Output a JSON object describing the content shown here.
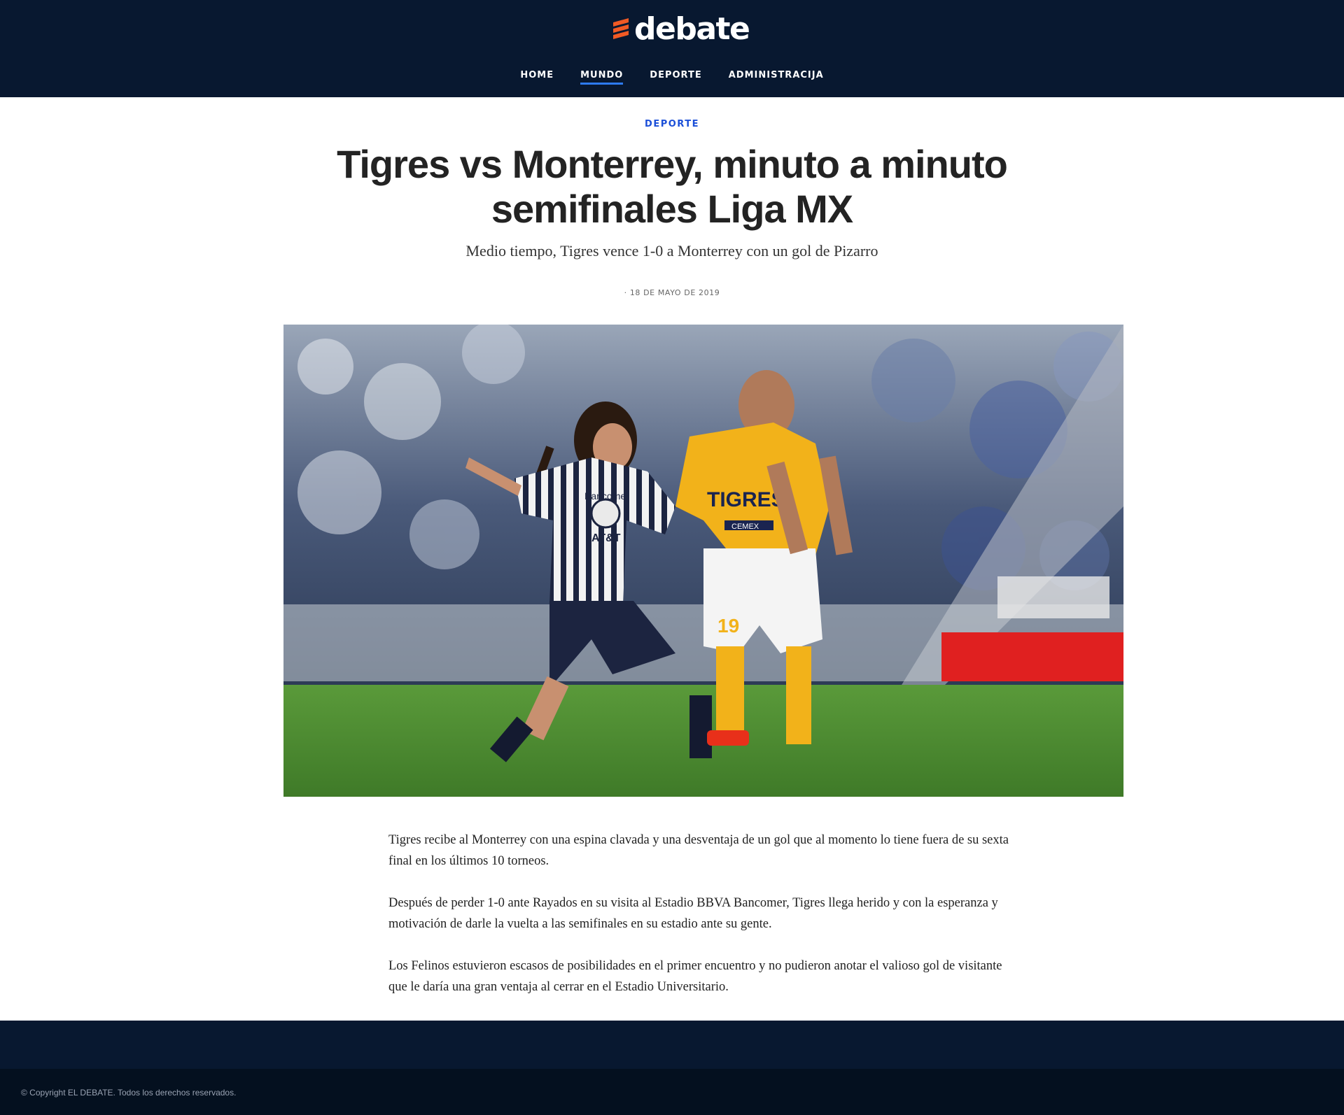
{
  "header": {
    "logo_text": "debate",
    "brand_color": "#f15a24",
    "nav": [
      {
        "label": "HOME",
        "active": false
      },
      {
        "label": "MUNDO",
        "active": true
      },
      {
        "label": "DEPORTE",
        "active": false
      },
      {
        "label": "ADMINISTRACIJA",
        "active": false
      }
    ]
  },
  "article": {
    "category": "DEPORTE",
    "title": "Tigres vs Monterrey, minuto a minuto semifinales Liga MX",
    "subtitle": "Medio tiempo, Tigres vence 1-0 a Monterrey con un gol de Pizarro",
    "date": "· 18 DE MAYO DE 2019",
    "hero_image": {
      "jersey_texts": [
        "BBVA Bancomer",
        "AT&T",
        "TIGRES",
        "CEMEX",
        "19"
      ]
    },
    "paragraphs": [
      "Tigres recibe al Monterrey con una espina clavada y una desventaja de un gol que al momento lo tiene fuera de su sexta final en los últimos 10 torneos.",
      "Después de perder 1-0 ante Rayados en su visita al Estadio BBVA Bancomer, Tigres llega herido y con la esperanza y motivación de darle la vuelta a las semifinales en su estadio ante su gente.",
      "Los Felinos estuvieron escasos de posibilidades en el primer encuentro y no pudieron anotar el valioso gol de visitante que le daría una gran ventaja al cerrar en el Estadio Universitario."
    ]
  },
  "footer": {
    "copyright": "© Copyright EL DEBATE. Todos los derechos reservados."
  },
  "colors": {
    "header_bg": "#081830",
    "accent_blue": "#1b4fd8",
    "nav_underline": "#2d7bf2"
  }
}
